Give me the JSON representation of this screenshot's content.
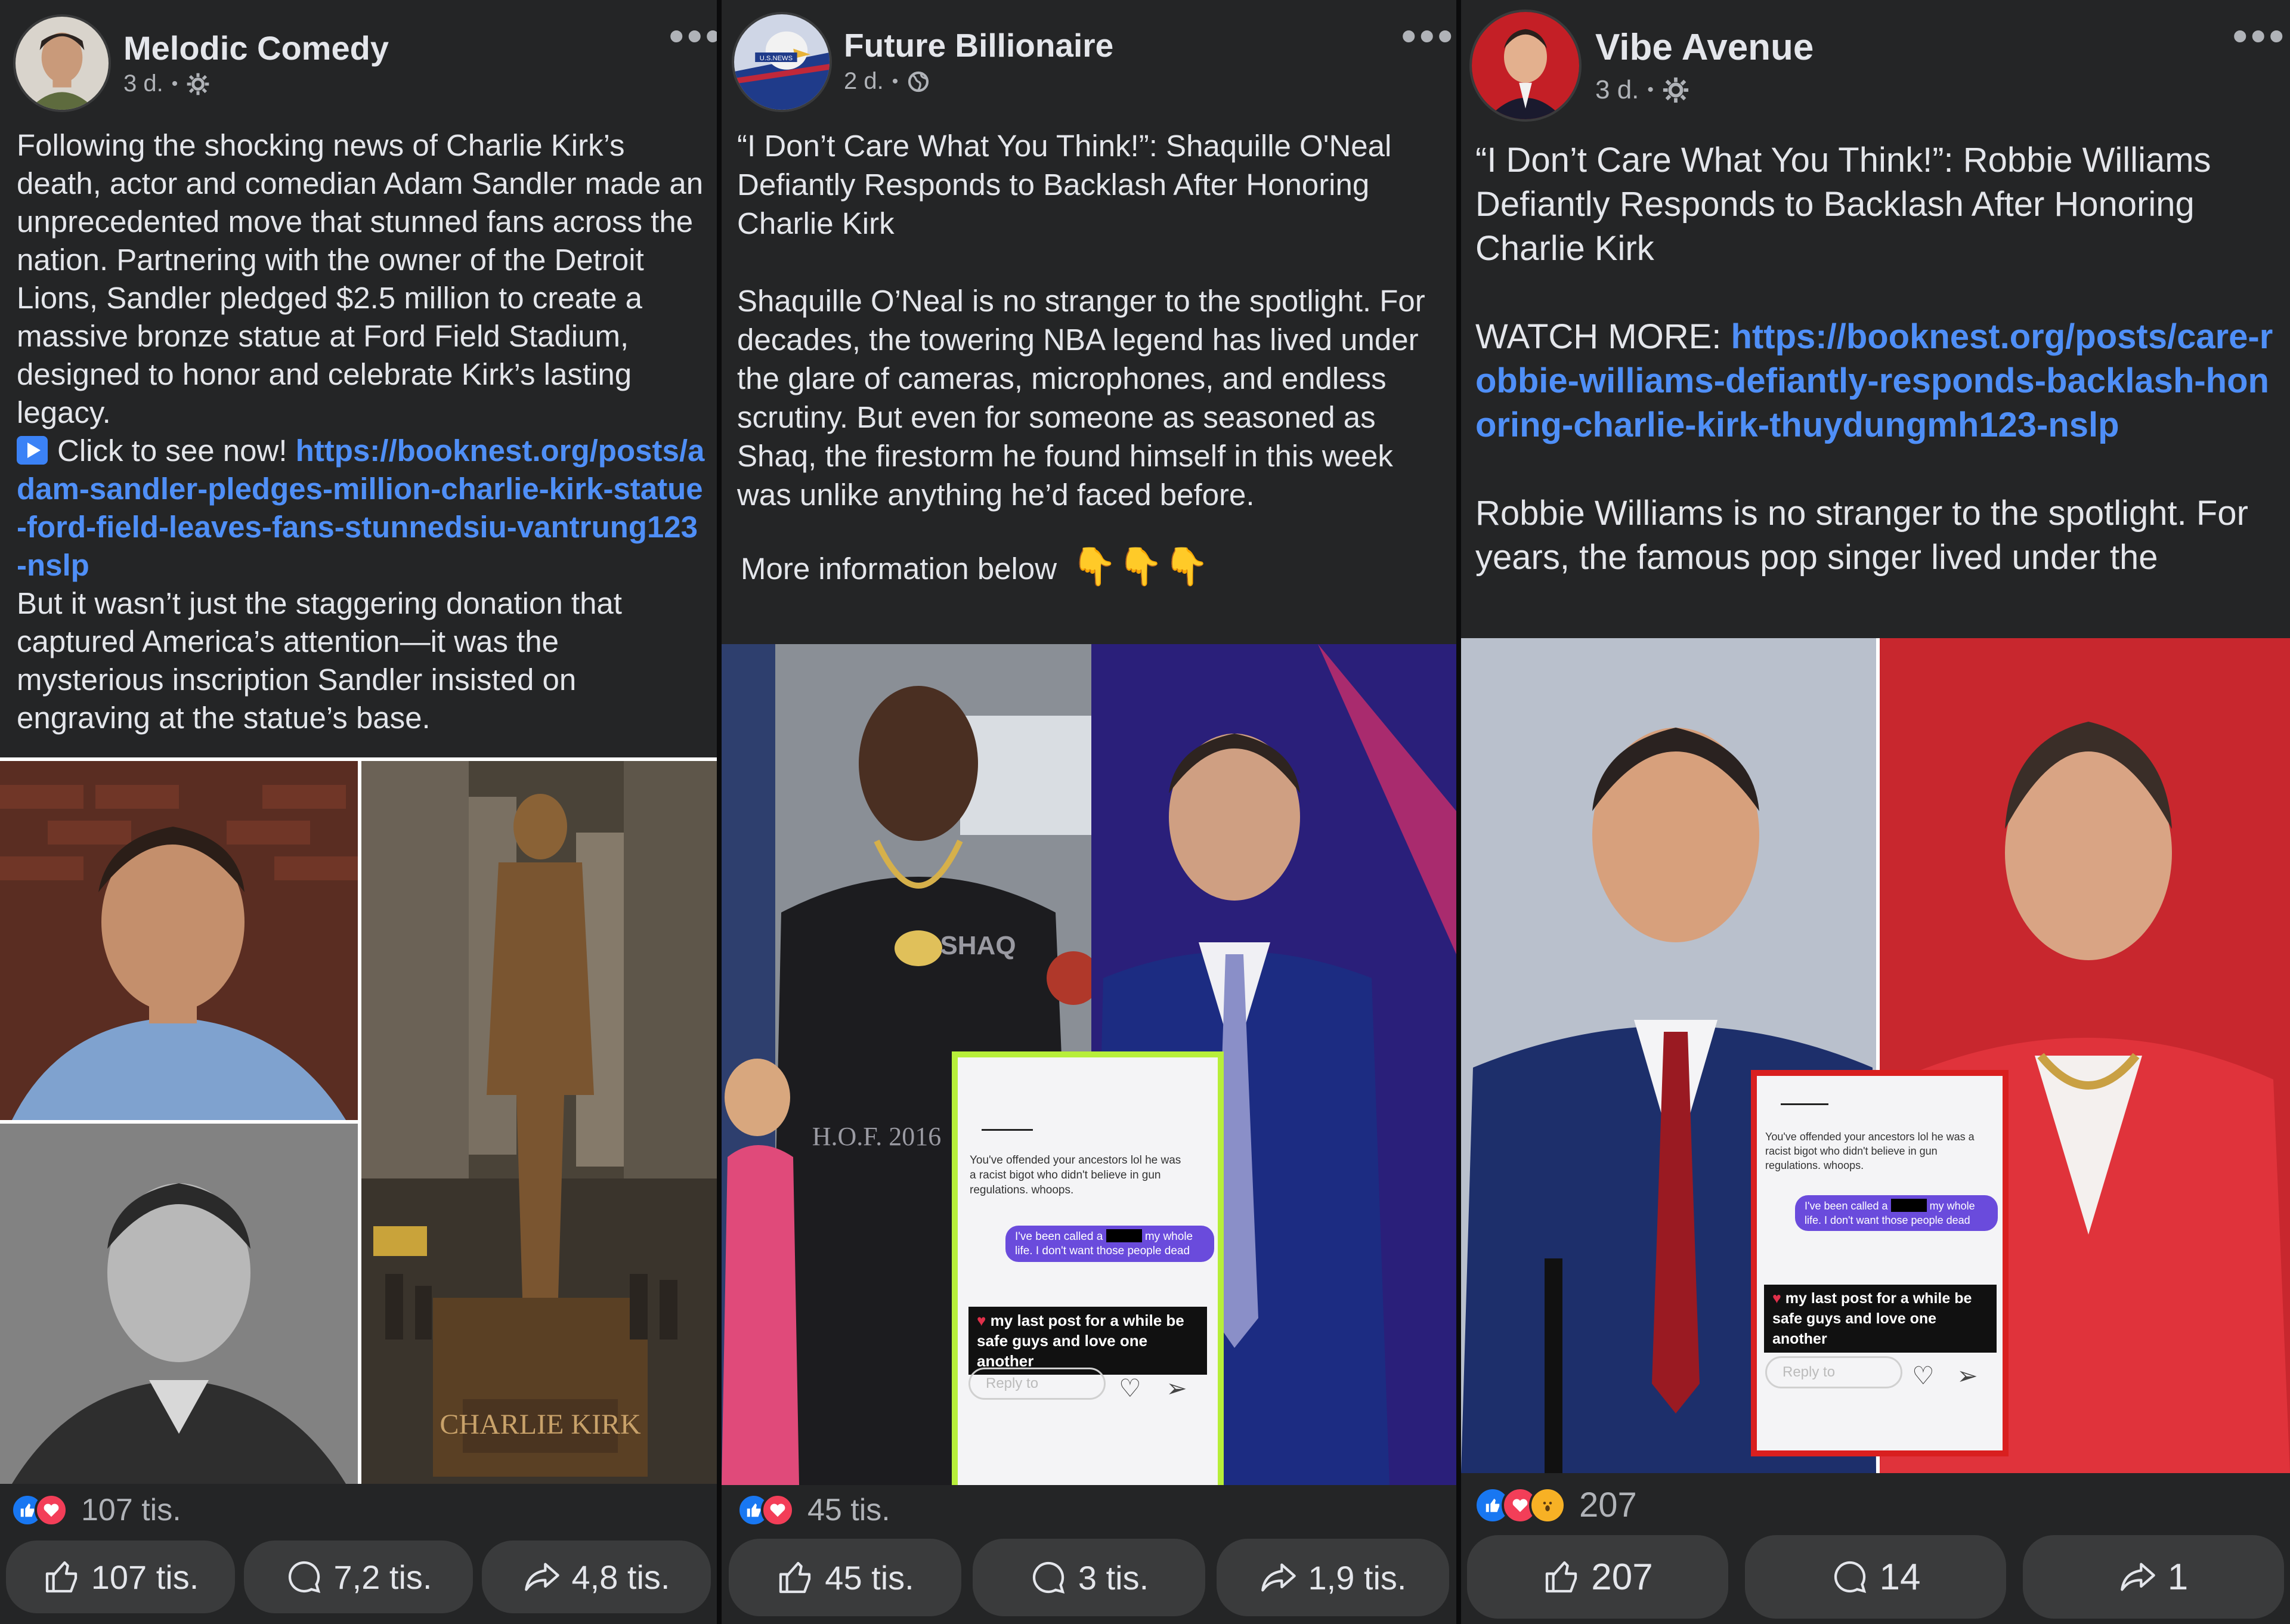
{
  "posts": [
    {
      "page_name": "Melodic Comedy",
      "time": "3 d.",
      "audience_icon": "gear-icon",
      "text_intro": "Following the shocking news of Charlie Kirk’s death, actor and comedian Adam Sandler made an unprecedented move that stunned fans across the nation. Partnering with the owner of the Detroit Lions, Sandler pledged $2.5 million to create a massive bronze statue at Ford Field Stadium, designed to honor and celebrate Kirk’s lasting legacy.",
      "cta": "Click to see now!",
      "link": "https://booknest.org/posts/adam-sandler-pledges-million-charlie-kirk-statue-ford-field-leaves-fans-stunnedsiu-vantrung123-nslp",
      "text_outro": "But it wasn’t just the staggering donation that captured America’s attention—it was the mysterious inscription Sandler insisted on engraving at the statue’s base.",
      "statue_plaque": "CHARLIE KIRK",
      "reaction_count": "107 tis.",
      "like_label": "107 tis.",
      "comment_label": "7,2 tis.",
      "share_label": "4,8 tis."
    },
    {
      "page_name": "Future Billionaire",
      "time": "2 d.",
      "audience_icon": "globe-icon",
      "avatar_text": "U.S.NEWS",
      "headline": "“I Don’t Care What You Think!”: Shaquille O'Neal Defiantly Responds to Backlash After Honoring Charlie Kirk",
      "paragraph": "Shaquille O’Neal is no stranger to the spotlight. For decades, the towering NBA legend has lived under the glare of cameras, microphones, and endless scrutiny. But even for someone as seasoned as Shaq, the firestorm he found himself in this week was unlike anything he’d faced before.",
      "more_info": "More information below",
      "hoodie_text": "SHAQ",
      "pants_text": "H.O.F. 2016",
      "dm": {
        "msg1": "You've offended your ancestors lol he was a racist bigot who didn't believe in gun regulations. whoops.",
        "bubble_a": "I've been called a",
        "bubble_b": "my whole life. I don't want those people dead",
        "caption": "my last post for a while be safe guys and love one another",
        "reply": "Reply to"
      },
      "reaction_count": "45 tis.",
      "like_label": "45 tis.",
      "comment_label": "3 tis.",
      "share_label": "1,9 tis."
    },
    {
      "page_name": "Vibe Avenue",
      "time": "3 d.",
      "audience_icon": "gear-icon",
      "headline": "“I Don’t Care What You Think!”: Robbie Williams Defiantly Responds to Backlash After Honoring Charlie Kirk",
      "watch_label": "WATCH MORE:",
      "link": "https://booknest.org/posts/care-robbie-williams-defiantly-responds-backlash-honoring-charlie-kirk-thuydungmh123-nslp",
      "paragraph": "Robbie Williams is no stranger to the spotlight. For years, the famous pop singer lived under the",
      "dm": {
        "msg1": "You've offended your ancestors lol he was a racist bigot who didn't believe in gun regulations. whoops.",
        "bubble_a": "I've been called a",
        "bubble_b": "my whole life. I don't want those people dead",
        "caption": "my last post for a while be safe guys and love one another",
        "reply": "Reply to"
      },
      "reaction_count": "207",
      "like_label": "207",
      "comment_label": "14",
      "share_label": "1"
    }
  ],
  "colors": {
    "card_bg": "#242526",
    "link": "#4f8ff7",
    "button_bg": "#3a3b3c",
    "like_blue": "#1877f2",
    "love_red": "#f33e58",
    "lime_frame": "#b7ee3a",
    "red_frame": "#d91f1f"
  },
  "icons": [
    "more-options-icon",
    "gear-icon",
    "globe-icon",
    "play-icon",
    "pointing-down-icon",
    "like-reaction-icon",
    "love-reaction-icon",
    "wow-reaction-icon",
    "thumbs-up-icon",
    "comment-icon",
    "share-icon",
    "heart-icon",
    "send-icon"
  ]
}
